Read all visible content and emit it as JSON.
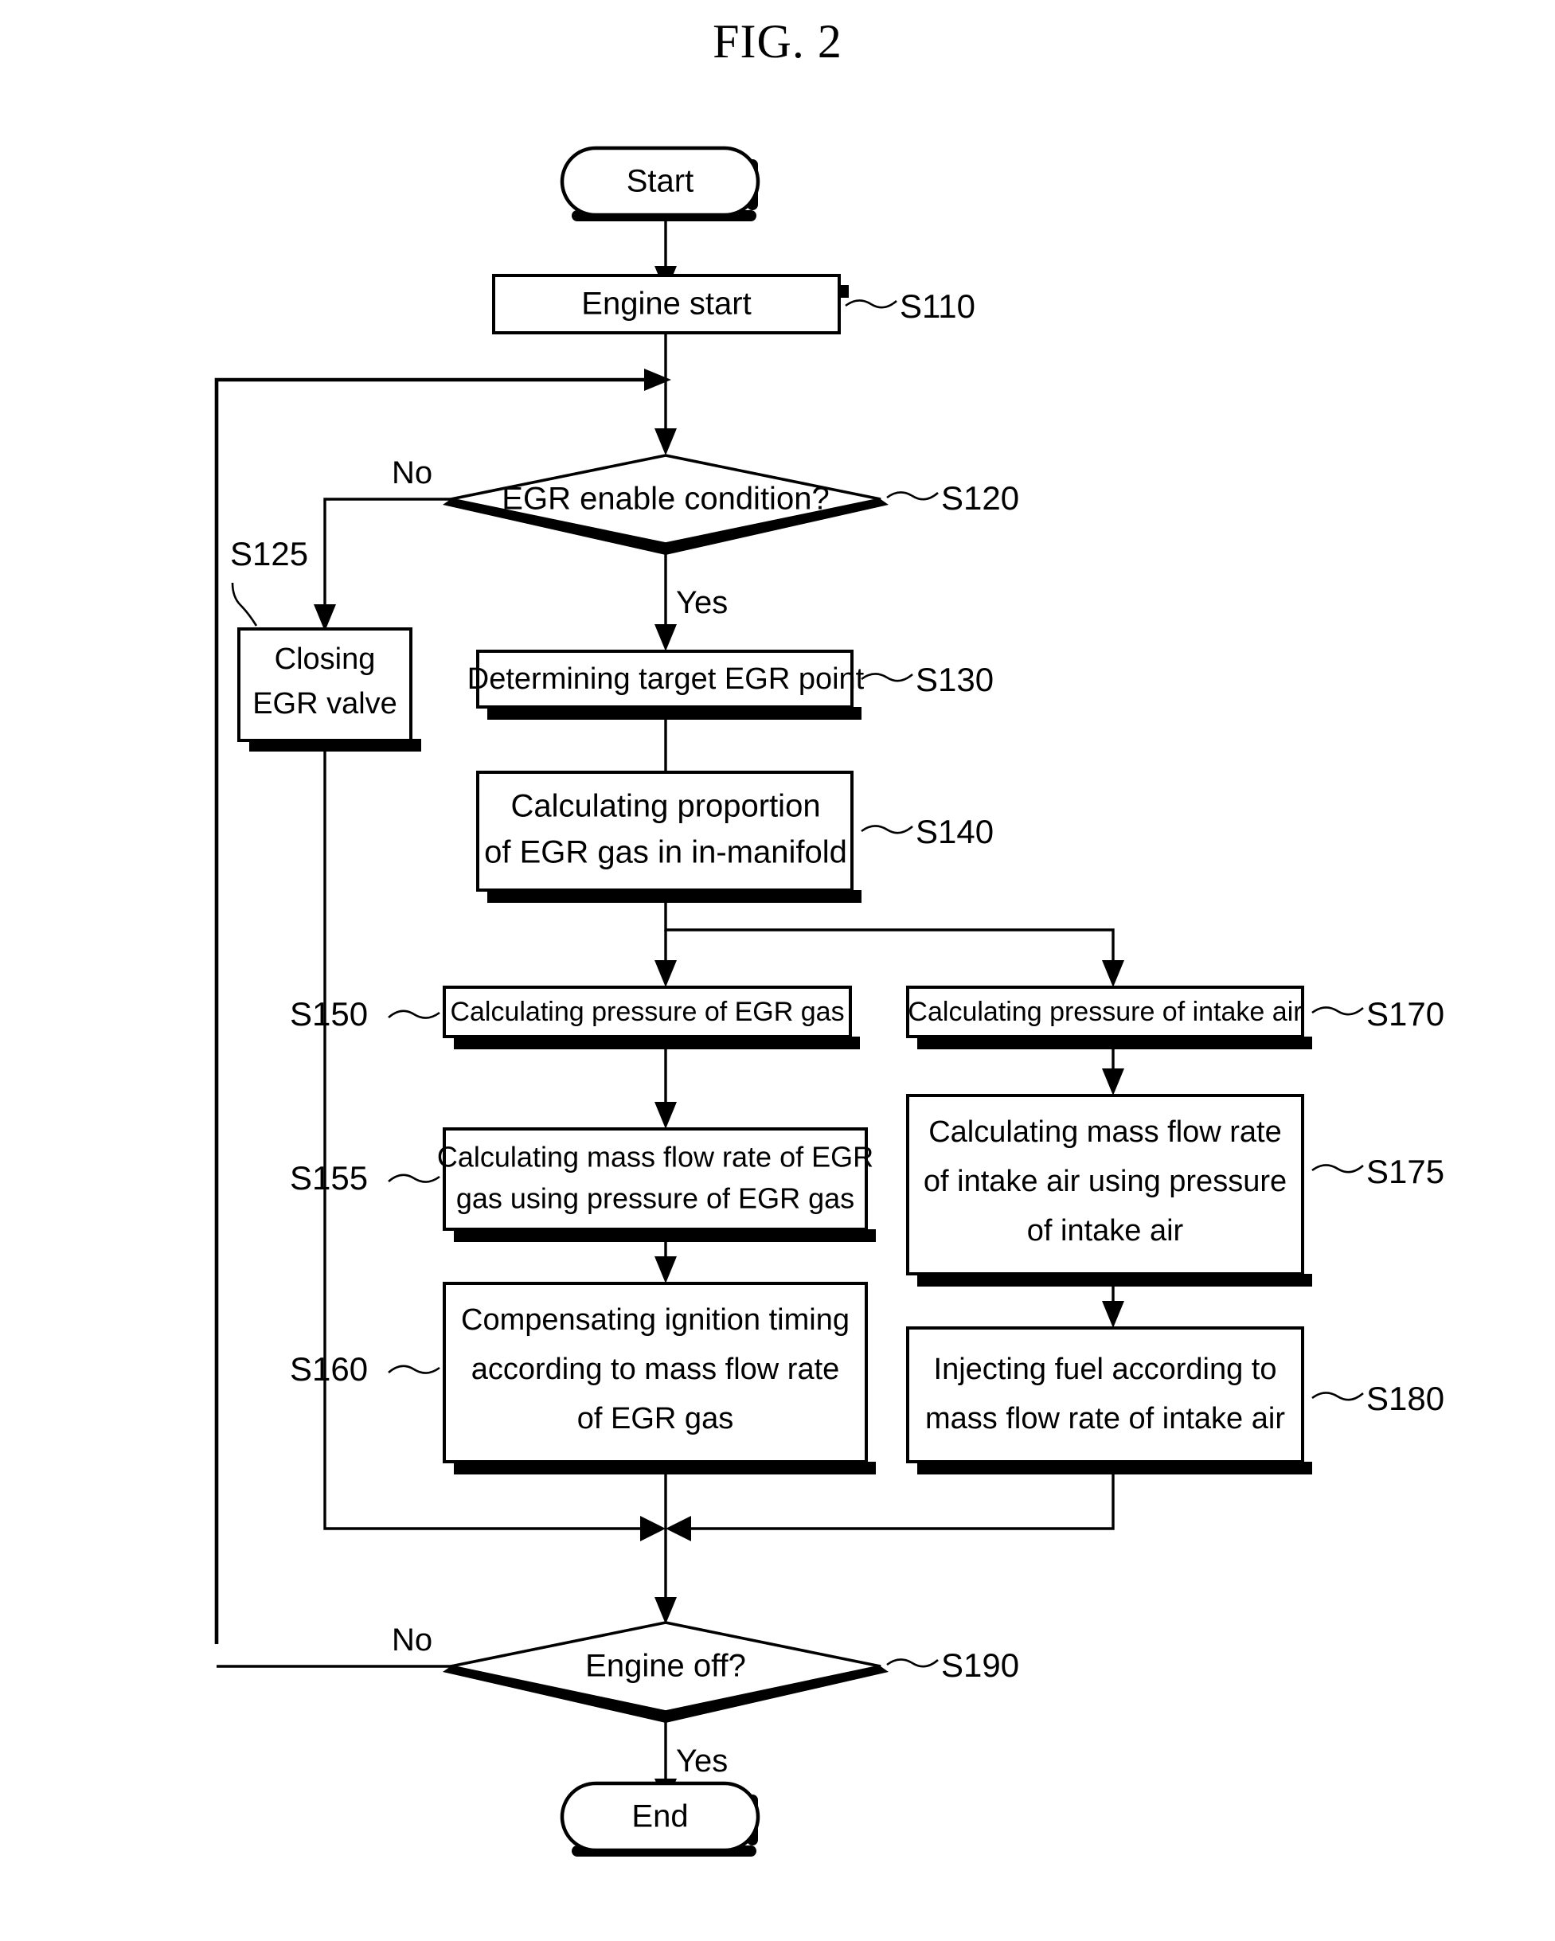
{
  "figure": {
    "title": "FIG. 2"
  },
  "flowchart": {
    "type": "flowchart",
    "nodes": [
      {
        "id": "start",
        "shape": "terminator",
        "label": "Start",
        "ref": ""
      },
      {
        "id": "s110",
        "shape": "process",
        "label": "Engine start",
        "ref": "S110"
      },
      {
        "id": "s120",
        "shape": "decision",
        "label": "EGR enable condition?",
        "ref": "S120"
      },
      {
        "id": "s125",
        "shape": "process",
        "label": "Closing\nEGR valve",
        "line1": "Closing",
        "line2": "EGR valve",
        "ref": "S125"
      },
      {
        "id": "s130",
        "shape": "process",
        "label": "Determining target EGR point",
        "ref": "S130"
      },
      {
        "id": "s140",
        "shape": "process",
        "label": "Calculating proportion\nof EGR gas in in-manifold",
        "line1": "Calculating proportion",
        "line2": "of EGR gas in in-manifold",
        "ref": "S140"
      },
      {
        "id": "s150",
        "shape": "process",
        "label": "Calculating pressure of EGR gas",
        "ref": "S150"
      },
      {
        "id": "s155",
        "shape": "process",
        "label": "Calculating mass flow rate of EGR\ngas using pressure of EGR gas",
        "line1": "Calculating mass flow rate of EGR",
        "line2": "gas using pressure of EGR gas",
        "ref": "S155"
      },
      {
        "id": "s160",
        "shape": "process",
        "label": "Compensating ignition timing\naccording to mass flow rate\nof EGR gas",
        "line1": "Compensating ignition timing",
        "line2": "according to mass flow rate",
        "line3": "of EGR gas",
        "ref": "S160"
      },
      {
        "id": "s170",
        "shape": "process",
        "label": "Calculating pressure of intake air",
        "ref": "S170"
      },
      {
        "id": "s175",
        "shape": "process",
        "label": "Calculating mass flow rate\nof intake air using pressure\nof intake air",
        "line1": "Calculating mass flow rate",
        "line2": "of intake air using pressure",
        "line3": "of intake air",
        "ref": "S175"
      },
      {
        "id": "s180",
        "shape": "process",
        "label": "Injecting fuel according to\nmass flow rate of intake air",
        "line1": "Injecting fuel according to",
        "line2": "mass flow rate of intake air",
        "ref": "S180"
      },
      {
        "id": "s190",
        "shape": "decision",
        "label": "Engine off?",
        "ref": "S190"
      },
      {
        "id": "end",
        "shape": "terminator",
        "label": "End",
        "ref": ""
      }
    ],
    "branch_labels": {
      "s120_no": "No",
      "s120_yes": "Yes",
      "s190_no": "No",
      "s190_yes": "Yes"
    },
    "colors": {
      "stroke": "#000000",
      "fill": "#ffffff",
      "shadow": "#000000"
    }
  }
}
